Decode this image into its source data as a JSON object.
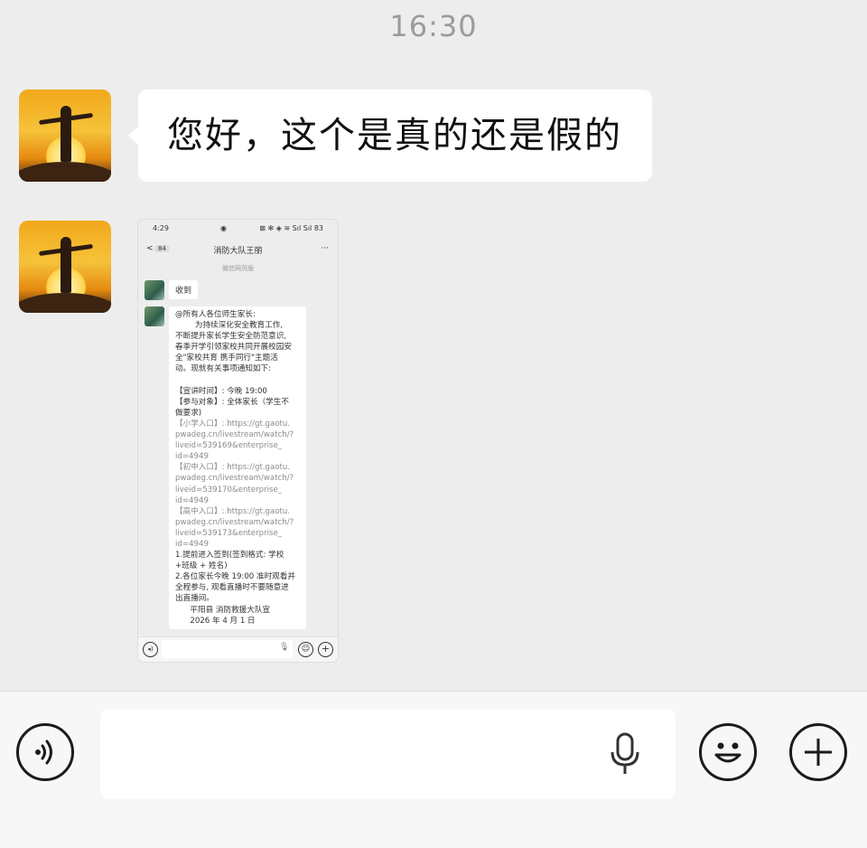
{
  "timestamp": "16:30",
  "messages": [
    {
      "type": "text",
      "text": "您好，这个是真的还是假的"
    },
    {
      "type": "image",
      "screenshot": {
        "status": {
          "time": "4:29",
          "right": "⊠ ✻ ◈ ≋ Sıl Sıl 83",
          "mid": "◉"
        },
        "nav": {
          "back": "<",
          "badge": "84",
          "title": "消防大队王丽",
          "more": "···"
        },
        "subtitle": "微信网页版",
        "msg1": "收到",
        "msg2_lines": [
          "@所有人各位师生家长:",
          "        为持续深化安全教育工作,",
          "不断提升家长学生安全防范意识,",
          "春季开学引领家校共同开展校园安",
          "全\"家校共育 携手同行\"主题活",
          "动。现就有关事项通知如下:",
          "",
          "【宣讲时间】: 今晚 19:00",
          "【参与对象】: 全体家长（学生不",
          "做要求)",
          "【小学入口】: https://gt.gaotu.",
          "pwadeg.cn/livestream/watch/?",
          "liveid=539169&enterprise_",
          "id=4949",
          "【初中入口】: https://gt.gaotu.",
          "pwadeg.cn/livestream/watch/?",
          "liveid=539170&enterprise_",
          "id=4949",
          "【高中入口】: https://gt.gaotu.",
          "pwadeg.cn/livestream/watch/?",
          "liveid=539173&enterprise_",
          "id=4949",
          "1.提前进入签到(签到格式: 学校",
          "+班级 + 姓名)",
          "2.各位家长今晚 19:00 准时观看并",
          "全程参与, 观看直播时不要随意进",
          "出直播间。",
          "      平阳县 消防救援大队宣",
          "      2026 年 4 月 1 日"
        ]
      }
    }
  ],
  "input_bar": {
    "voice_icon": "voice-icon",
    "mic_icon": "microphone-icon",
    "emoji_icon": "emoji-icon",
    "plus_icon": "plus-icon"
  }
}
